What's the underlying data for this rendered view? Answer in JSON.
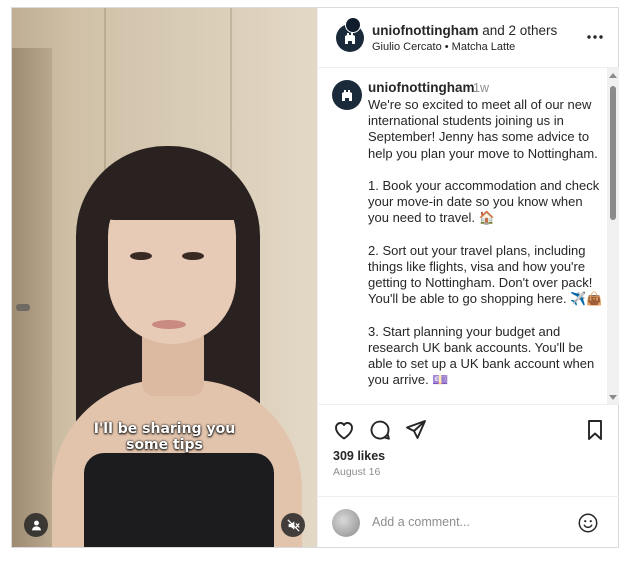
{
  "video": {
    "subtitle_line1": "I'll be sharing you",
    "subtitle_line2": "some tips",
    "user_tag_icon": "person-icon",
    "mute_icon": "speaker-muted-icon"
  },
  "header": {
    "username": "uniofnottingham",
    "and_others": " and 2 others",
    "subtitle": "Giulio Cercato • Matcha Latte",
    "more_icon": "more-horizontal-icon"
  },
  "post_caption": {
    "username": "uniofnottingham",
    "time": "1w",
    "text": "We're so excited to meet all of our new international students joining us in September! Jenny has some advice to help you plan your move to Nottingham.\n\n1. Book your accommodation and check your move-in date so you know when you need to travel. 🏠\n\n2. Sort out your travel plans, including things like flights, visa and how you're getting to Nottingham. Don't over pack! You'll be able to go shopping here. ✈️👜\n\n3. Start planning your budget and research UK bank accounts. You'll be able to set up a UK bank account when you arrive. 💷"
  },
  "actions": {
    "like_icon": "heart-icon",
    "comment_icon": "comment-icon",
    "share_icon": "send-icon",
    "save_icon": "bookmark-icon"
  },
  "stats": {
    "likes": "309 likes",
    "date": "August 16"
  },
  "comment": {
    "placeholder": "Add a comment...",
    "emoji_icon": "smiley-icon"
  },
  "colors": {
    "text": "#262626",
    "muted": "#8e8e8e",
    "border": "#dbdbdb",
    "avatar_bg": "#1b2a3a"
  }
}
